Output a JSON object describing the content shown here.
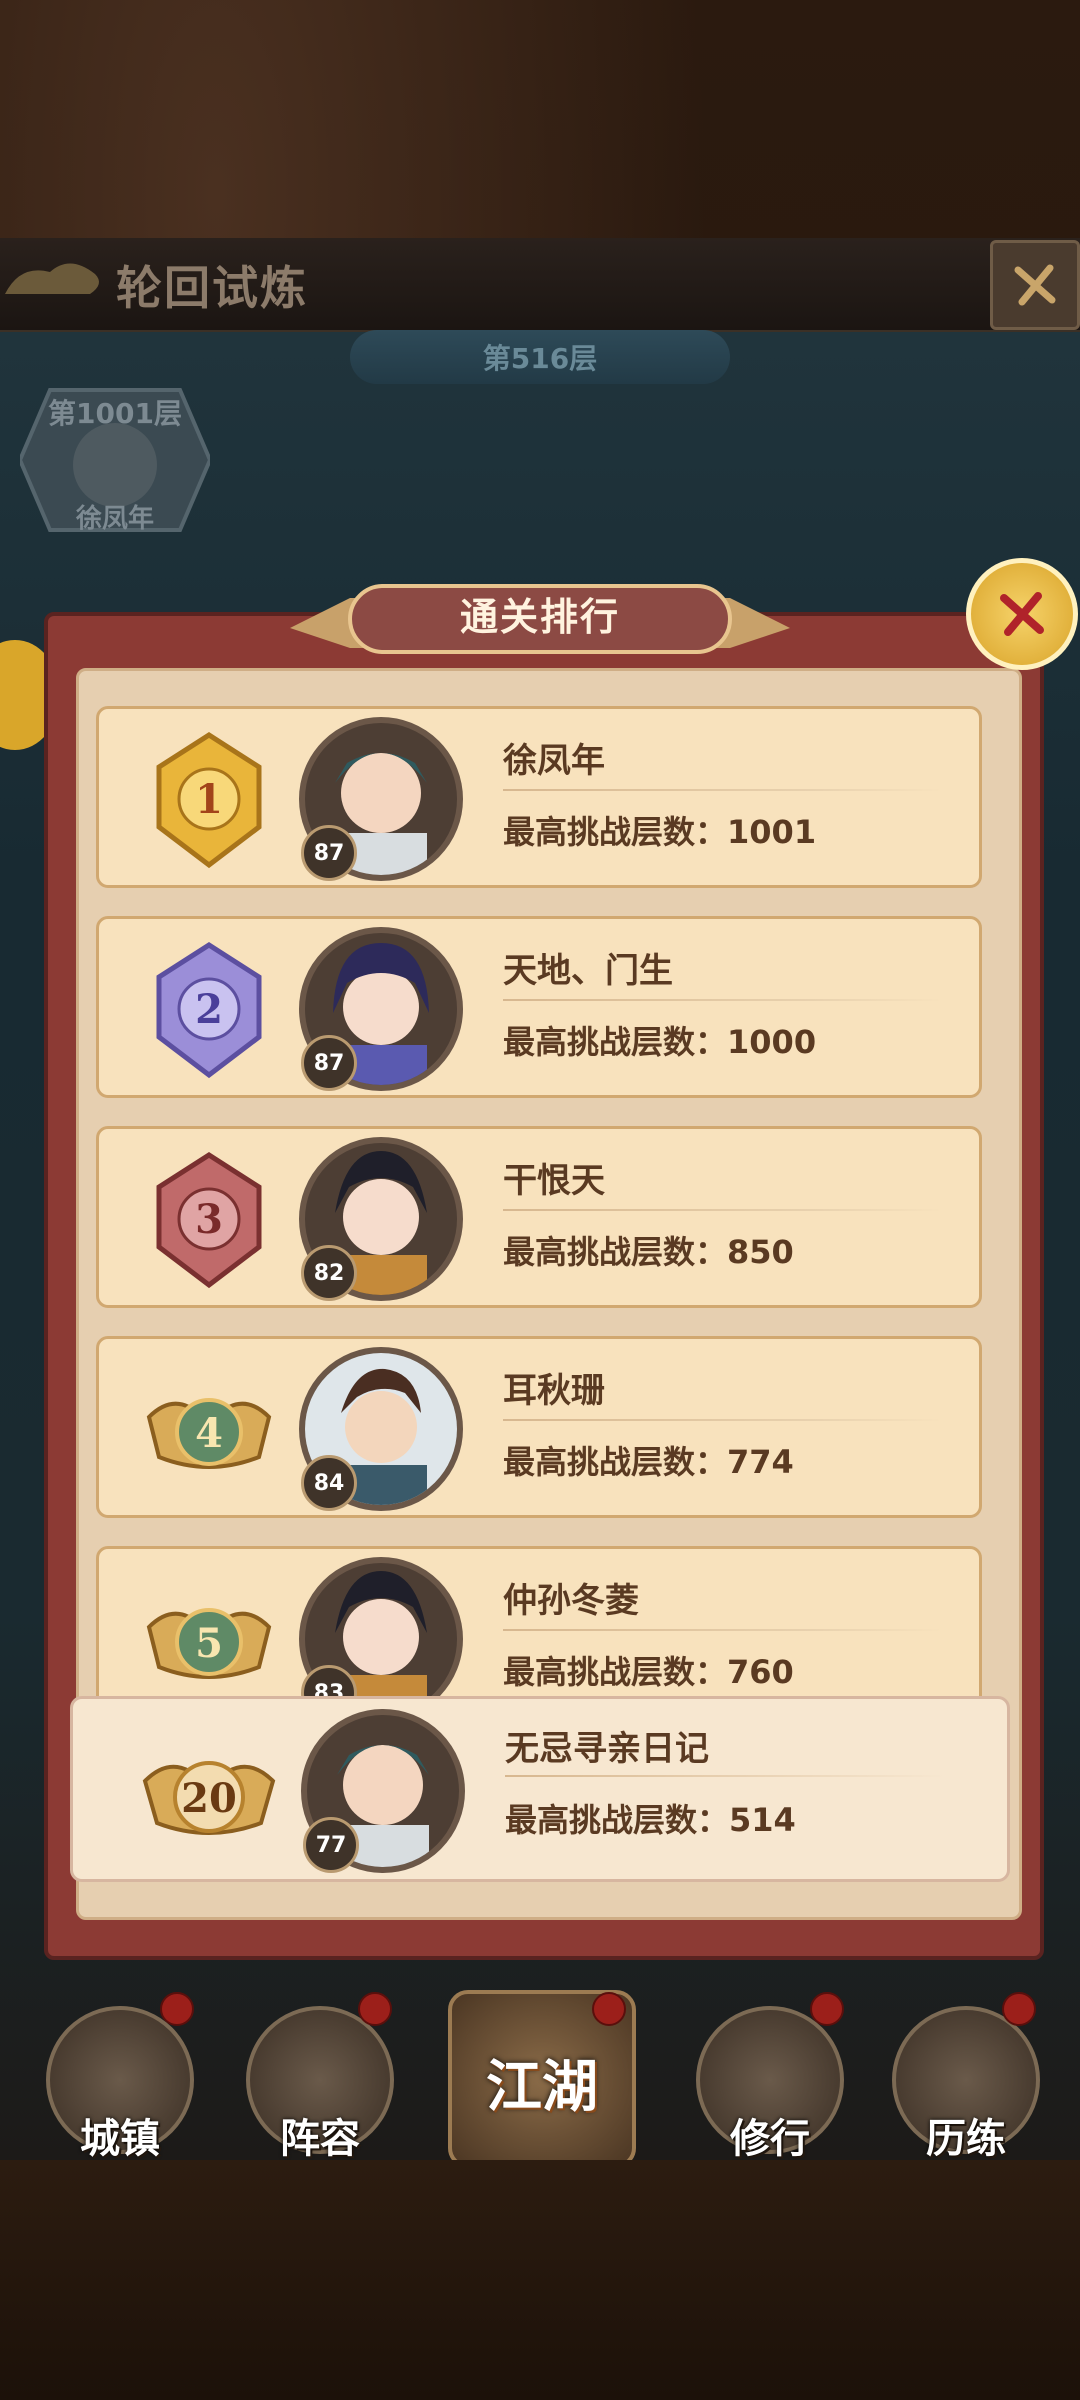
{
  "header": {
    "title": "轮回试炼",
    "floor_banner": "第516层",
    "top_badge": {
      "floor": "第1001层",
      "name": "徐凤年"
    }
  },
  "panel": {
    "title": "通关排行",
    "rows": [
      {
        "rank": "1",
        "name": "徐凤年",
        "score_label": "最高挑战层数：",
        "score": "1001",
        "level": "87",
        "medal_color": "#e9b53a"
      },
      {
        "rank": "2",
        "name": "天地、门生",
        "score_label": "最高挑战层数：",
        "score": "1000",
        "level": "87",
        "medal_color": "#9b8ed8"
      },
      {
        "rank": "3",
        "name": "干恨天",
        "score_label": "最高挑战层数：",
        "score": "850",
        "level": "82",
        "medal_color": "#c06a6a"
      },
      {
        "rank": "4",
        "name": "耳秋珊",
        "score_label": "最高挑战层数：",
        "score": "774",
        "level": "84",
        "medal_color": "#5f8a66"
      },
      {
        "rank": "5",
        "name": "仲孙冬菱",
        "score_label": "最高挑战层数：",
        "score": "760",
        "level": "83",
        "medal_color": "#5f8a66"
      }
    ],
    "my_row": {
      "rank": "20",
      "name": "无忌寻亲日记",
      "score_label": "最高挑战层数：",
      "score": "514",
      "level": "77"
    }
  },
  "nav": [
    {
      "label": "城镇"
    },
    {
      "label": "阵容"
    },
    {
      "label": "江湖"
    },
    {
      "label": "修行"
    },
    {
      "label": "历练"
    }
  ],
  "colors": {
    "panel_frame": "#8c3a34",
    "panel_bg": "#e6cfb0",
    "row_bg": "#f8e2bd",
    "text": "#5a3a22"
  }
}
